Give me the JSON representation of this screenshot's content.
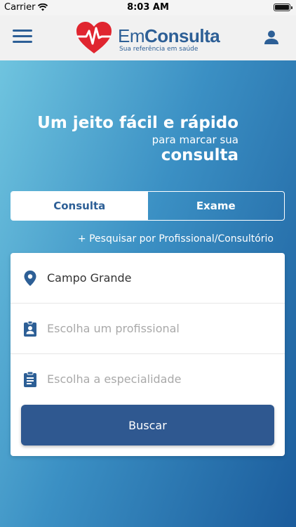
{
  "status_bar": {
    "carrier": "Carrier",
    "time": "8:03 AM"
  },
  "header": {
    "logo_em": "Em",
    "logo_consulta": "Consulta",
    "logo_tagline": "Sua referência em saúde"
  },
  "hero": {
    "line1": "Um jeito fácil e rápido",
    "line2": "para marcar sua",
    "line3": "consulta"
  },
  "tabs": [
    {
      "label": "Consulta",
      "active": true
    },
    {
      "label": "Exame",
      "active": false
    }
  ],
  "search_link": "+ Pesquisar por Profissional/Consultório",
  "form": {
    "location_value": "Campo Grande",
    "professional_placeholder": "Escolha um profissional",
    "specialty_placeholder": "Escolha a especialidade",
    "submit_label": "Buscar"
  },
  "colors": {
    "brand_blue": "#2d5f96",
    "logo_red": "#e0252f",
    "button_blue": "#2f5890"
  },
  "icons": [
    "menu-icon",
    "user-icon",
    "map-pin-icon",
    "badge-icon",
    "clipboard-icon",
    "heart-pulse-icon",
    "wifi-icon",
    "battery-icon"
  ]
}
